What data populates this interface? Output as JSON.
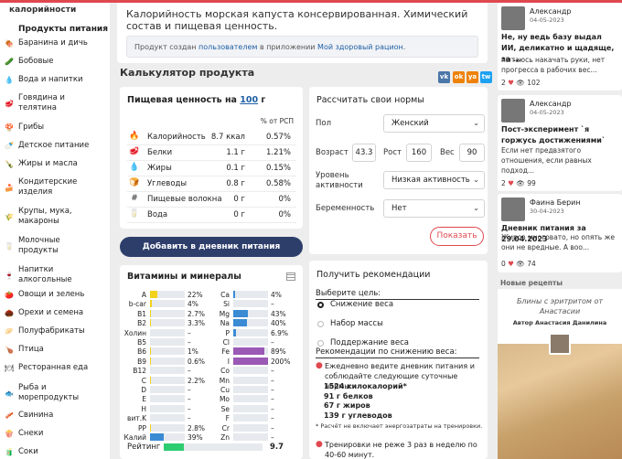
{
  "sidebar": {
    "sub": "калорийности",
    "heading": "Продукты питания",
    "items": [
      {
        "label": "Баранина и дичь",
        "icon": "meat-icon",
        "glyph": "🍖"
      },
      {
        "label": "Бобовые",
        "icon": "beans-icon",
        "glyph": "🥒"
      },
      {
        "label": "Вода и напитки",
        "icon": "water-icon",
        "glyph": "💧"
      },
      {
        "label": "Говядина и телятина",
        "icon": "beef-icon",
        "glyph": "🥩"
      },
      {
        "label": "Грибы",
        "icon": "mushroom-icon",
        "glyph": "🍄"
      },
      {
        "label": "Детское питание",
        "icon": "baby-food-icon",
        "glyph": "🍼"
      },
      {
        "label": "Жиры и масла",
        "icon": "oil-icon",
        "glyph": "🍾"
      },
      {
        "label": "Кондитерские изделия",
        "icon": "cake-icon",
        "glyph": "🍰"
      },
      {
        "label": "Крупы, мука, макароны",
        "icon": "grain-icon",
        "glyph": "🌾"
      },
      {
        "label": "Молочные продукты",
        "icon": "milk-icon",
        "glyph": "🥛"
      },
      {
        "label": "Напитки алкогольные",
        "icon": "wine-icon",
        "glyph": "🍷"
      },
      {
        "label": "Овощи и зелень",
        "icon": "tomato-icon",
        "glyph": "🍅"
      },
      {
        "label": "Орехи и семена",
        "icon": "nut-icon",
        "glyph": "🌰"
      },
      {
        "label": "Полуфабрикаты",
        "icon": "dumpling-icon",
        "glyph": "🥟"
      },
      {
        "label": "Птица",
        "icon": "chicken-icon",
        "glyph": "🍗"
      },
      {
        "label": "Ресторанная еда",
        "icon": "restaurant-icon",
        "glyph": "🍽"
      },
      {
        "label": "Рыба и морепродукты",
        "icon": "fish-icon",
        "glyph": "🐟"
      },
      {
        "label": "Свинина",
        "icon": "pork-icon",
        "glyph": "🥓"
      },
      {
        "label": "Снеки",
        "icon": "snack-icon",
        "glyph": "🍿"
      },
      {
        "label": "Соки",
        "icon": "juice-icon",
        "glyph": "🧃"
      }
    ]
  },
  "header": {
    "title": "Калорийность морская капуста консервированная. Химический состав и пищевая ценность.",
    "note_prefix": "Продукт создан",
    "note_user": "пользователем",
    "note_mid": "в приложении",
    "note_app": "Мой здоровый рацион",
    "note_end": "."
  },
  "calc": {
    "title": "Калькулятор продукта",
    "share": [
      {
        "label": "vk",
        "color": "#4a76a8"
      },
      {
        "label": "ok",
        "color": "#ee8208"
      },
      {
        "label": "ya",
        "color": "#ee8208"
      },
      {
        "label": "tw",
        "color": "#1da1f2"
      }
    ]
  },
  "nutrition": {
    "heading_prefix": "Пищевая ценность на",
    "amount": "100",
    "unit": "г",
    "col_pct": "% от РСП",
    "rows": [
      {
        "name": "Калорийность",
        "value": "8.7 ккал",
        "pct": "0.57%",
        "glyph": "🔥",
        "icon": "fire-icon"
      },
      {
        "name": "Белки",
        "value": "1.1 г",
        "pct": "1.21%",
        "glyph": "🥩",
        "icon": "protein-icon"
      },
      {
        "name": "Жиры",
        "value": "0.1 г",
        "pct": "0.15%",
        "glyph": "💧",
        "icon": "fat-drop-icon"
      },
      {
        "name": "Углеводы",
        "value": "0.8 г",
        "pct": "0.58%",
        "glyph": "🍞",
        "icon": "carbs-icon"
      },
      {
        "name": "Пищевые волокна",
        "value": "0 г",
        "pct": "0%",
        "glyph": "#",
        "icon": "fiber-icon"
      },
      {
        "name": "Вода",
        "value": "0 г",
        "pct": "0%",
        "glyph": "🥛",
        "icon": "water-glass-icon"
      }
    ],
    "add_button": "Добавить в дневник питания"
  },
  "norms": {
    "heading": "Рассчитать свои нормы",
    "sex_label": "Пол",
    "sex_value": "Женский",
    "age_label": "Возраст",
    "age_value": "43.3",
    "height_label": "Рост",
    "height_value": "160",
    "weight_label": "Вес",
    "weight_value": "90",
    "activity_label": "Уровень активности",
    "activity_value": "Низкая активность",
    "pregnancy_label": "Беременность",
    "pregnancy_value": "Нет",
    "show_button": "Показать"
  },
  "vitamins": {
    "heading": "Витамины и минералы",
    "left": [
      {
        "n": "A",
        "p": "22%",
        "v": 22,
        "c": "#f3d21c"
      },
      {
        "n": "b-car",
        "p": "4%",
        "v": 4,
        "c": "#f3d21c"
      },
      {
        "n": "B1",
        "p": "2.7%",
        "v": 2.7,
        "c": "#f3d21c"
      },
      {
        "n": "B2",
        "p": "3.3%",
        "v": 3.3,
        "c": "#f3d21c"
      },
      {
        "n": "Холин",
        "p": "–",
        "v": 0,
        "c": "#f3d21c"
      },
      {
        "n": "B5",
        "p": "–",
        "v": 0,
        "c": "#f3d21c"
      },
      {
        "n": "B6",
        "p": "1%",
        "v": 1,
        "c": "#f3d21c"
      },
      {
        "n": "B9",
        "p": "0.6%",
        "v": 0.6,
        "c": "#f3d21c"
      },
      {
        "n": "B12",
        "p": "–",
        "v": 0,
        "c": "#f3d21c"
      },
      {
        "n": "C",
        "p": "2.2%",
        "v": 2.2,
        "c": "#f3d21c"
      },
      {
        "n": "D",
        "p": "–",
        "v": 0,
        "c": "#f3d21c"
      },
      {
        "n": "E",
        "p": "–",
        "v": 0,
        "c": "#f3d21c"
      },
      {
        "n": "H",
        "p": "–",
        "v": 0,
        "c": "#f3d21c"
      },
      {
        "n": "вит.K",
        "p": "–",
        "v": 0,
        "c": "#f3d21c"
      },
      {
        "n": "PP",
        "p": "2.8%",
        "v": 2.8,
        "c": "#f3d21c"
      },
      {
        "n": "Калий",
        "p": "39%",
        "v": 39,
        "c": "#3a8bd4"
      }
    ],
    "right": [
      {
        "n": "Ca",
        "p": "4%",
        "v": 4,
        "c": "#3a8bd4"
      },
      {
        "n": "Si",
        "p": "–",
        "v": 0,
        "c": "#3a8bd4"
      },
      {
        "n": "Mg",
        "p": "43%",
        "v": 43,
        "c": "#3a8bd4"
      },
      {
        "n": "Na",
        "p": "40%",
        "v": 40,
        "c": "#3a8bd4"
      },
      {
        "n": "P",
        "p": "6.9%",
        "v": 6.9,
        "c": "#3a8bd4"
      },
      {
        "n": "Cl",
        "p": "–",
        "v": 0,
        "c": "#9b59b6"
      },
      {
        "n": "Fe",
        "p": "89%",
        "v": 89,
        "c": "#9b59b6"
      },
      {
        "n": "I",
        "p": "200%",
        "v": 100,
        "c": "#9b59b6"
      },
      {
        "n": "Co",
        "p": "–",
        "v": 0,
        "c": "#9b59b6"
      },
      {
        "n": "Mn",
        "p": "–",
        "v": 0,
        "c": "#9b59b6"
      },
      {
        "n": "Cu",
        "p": "–",
        "v": 0,
        "c": "#9b59b6"
      },
      {
        "n": "Mo",
        "p": "–",
        "v": 0,
        "c": "#9b59b6"
      },
      {
        "n": "Se",
        "p": "–",
        "v": 0,
        "c": "#9b59b6"
      },
      {
        "n": "F",
        "p": "–",
        "v": 0,
        "c": "#9b59b6"
      },
      {
        "n": "Cr",
        "p": "–",
        "v": 0,
        "c": "#9b59b6"
      },
      {
        "n": "Zn",
        "p": "–",
        "v": 0,
        "c": "#9b59b6"
      }
    ],
    "rating_label": "Рейтинг",
    "rating_value": "9.7",
    "rating_fill": 20
  },
  "recs": {
    "heading": "Получить рекомендации",
    "goal_label": "Выберите цель:",
    "options": [
      "Снижение веса",
      "Набор массы",
      "Поддержание веса"
    ],
    "selected": 0,
    "sub_label": "Рекомендации по снижению веса:",
    "tip1": "Ежедневно ведите дневник питания и соблюдайте следующие суточные нормы:",
    "norm_lines": [
      "1524 килокалорий*",
      "91 г белков",
      "67 г жиров",
      "139 г углеводов"
    ],
    "footnote": "* Расчёт не включает энергозатраты на тренировки.",
    "tip2": "Тренировки не реже 3 раз в неделю по 40-60 минут."
  },
  "feed": [
    {
      "name": "Александр",
      "date": "04-05-2023",
      "title": "Не, ну ведь базу выдал ИИ, деликатно и щадяще, за ...",
      "body": "пытаюсь накачать руки, нет прогресса в рабочих вес...",
      "likes": "2",
      "views": "102"
    },
    {
      "name": "Александр",
      "date": "04-05-2023",
      "title": "Пост-эксперимент `я горжусь достижениями`",
      "body": "Если нет предвзятого отношения, если равных подход...",
      "likes": "2",
      "views": "99"
    },
    {
      "name": "Фаина Берин",
      "date": "30-04-2023",
      "title": "Дневник питания за 29.04.2023",
      "body": "Жиров многовато, но опять же они не вредные. А воо...",
      "likes": "0",
      "views": "74"
    }
  ],
  "new_recipes": {
    "label": "Новые рецепты",
    "title": "Блины с эритритом от Анастасии",
    "author": "Автор Анастасия Данилина"
  }
}
